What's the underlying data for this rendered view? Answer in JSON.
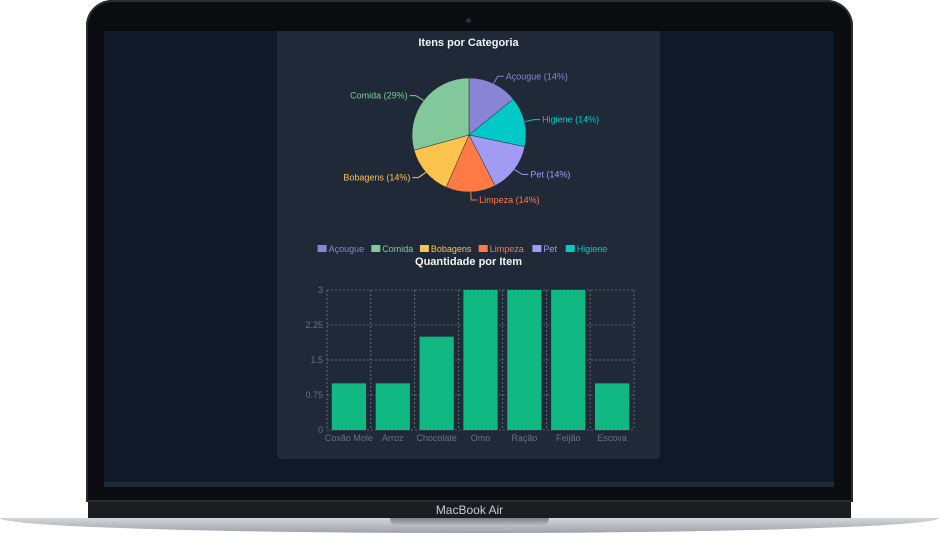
{
  "device": {
    "brand_label": "MacBook Air"
  },
  "pie_chart": {
    "title": "Itens por Categoria",
    "chart_data": {
      "type": "pie",
      "slices": [
        {
          "label": "Açougue",
          "value": 14,
          "color": "#8a84d6"
        },
        {
          "label": "Higiene",
          "value": 14,
          "color": "#00c9c8"
        },
        {
          "label": "Pet",
          "value": 14,
          "color": "#a29bf4"
        },
        {
          "label": "Limpeza",
          "value": 14,
          "color": "#ff7a45"
        },
        {
          "label": "Bobagens",
          "value": 14,
          "color": "#fdc44d"
        },
        {
          "label": "Comida",
          "value": 29,
          "color": "#82c89b"
        }
      ],
      "slice_labels": {
        "Açougue": "Açougue (14%)",
        "Higiene": "Higiene (14%)",
        "Pet": "Pet (14%)",
        "Limpeza": "Limpeza (14%)",
        "Bobagens": "Bobagens (14%)",
        "Comida": "Comida (29%)"
      },
      "legend": [
        "Açougue",
        "Comida",
        "Bobagens",
        "Limpeza",
        "Pet",
        "Higiene"
      ],
      "legend_placement": "bottom"
    }
  },
  "bar_chart": {
    "title": "Quantidade por Item",
    "chart_data": {
      "type": "bar",
      "categories": [
        "Coxão Mole",
        "Arroz",
        "Chocolate",
        "Omo",
        "Ração",
        "Feijão",
        "Escova"
      ],
      "values": [
        1,
        1,
        2,
        3,
        3,
        3,
        1
      ],
      "yticks": [
        "0",
        "0.75",
        "1.5",
        "2.25",
        "3"
      ],
      "ylim": [
        0,
        3
      ],
      "grid": true,
      "bar_color": "#10b981",
      "grid_color": "#8b95a3",
      "tick_color": "#6b7280"
    }
  }
}
